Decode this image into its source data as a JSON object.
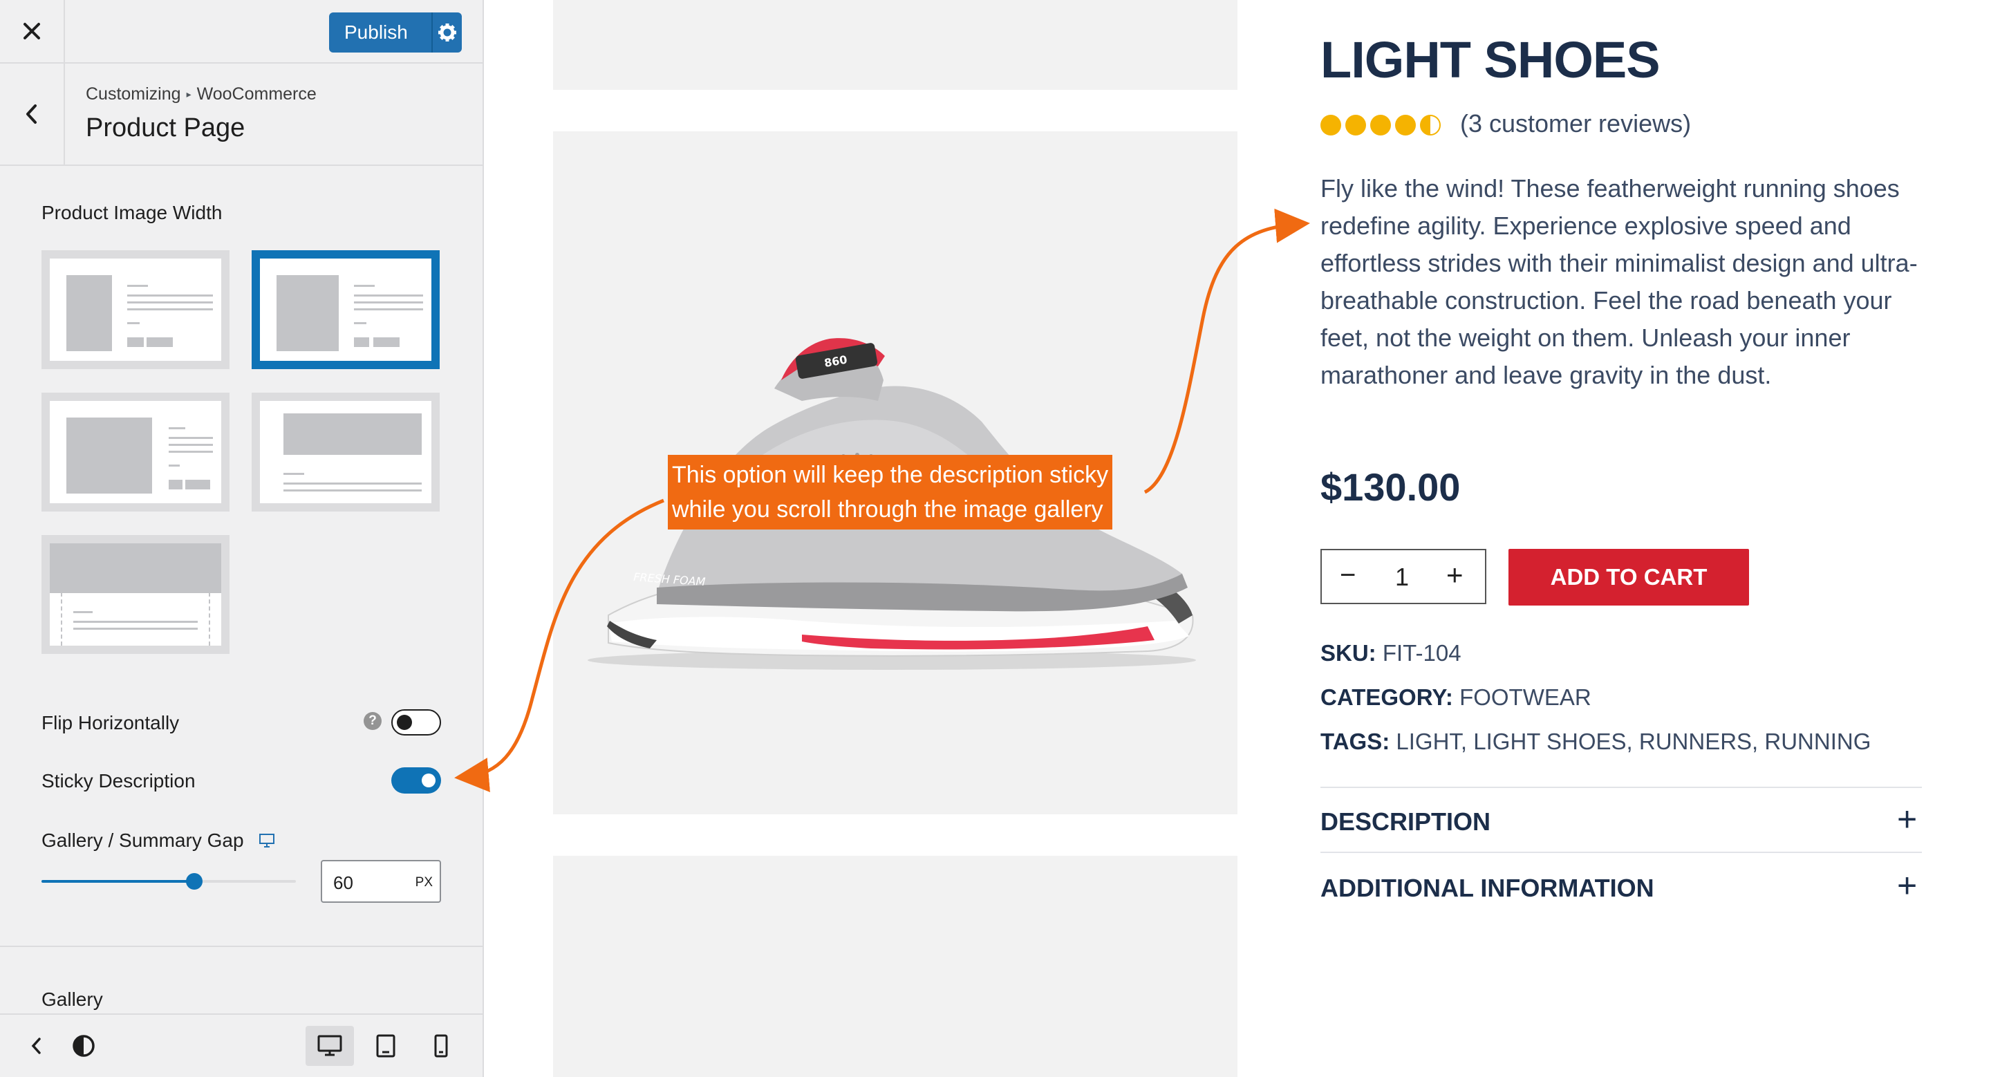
{
  "sidebar": {
    "publish_label": "Publish",
    "breadcrumb": {
      "root": "Customizing",
      "separator": "▸",
      "section": "WooCommerce"
    },
    "panel_title": "Product Page",
    "image_width_label": "Product Image Width",
    "flip_label": "Flip Horizontally",
    "flip_help": "?",
    "flip_enabled": false,
    "sticky_label": "Sticky Description",
    "sticky_enabled": true,
    "gap_label": "Gallery / Summary Gap",
    "gap_value": "60",
    "gap_unit": "PX",
    "gap_fraction": 0.6,
    "gallery_label": "Gallery"
  },
  "callout": {
    "line1": "This option will keep the description sticky",
    "line2": "while you scroll through the image gallery"
  },
  "product": {
    "title": "LIGHT SHOES",
    "rating": 4.5,
    "reviews": "(3 customer reviews)",
    "description": "Fly like the wind! These featherweight running shoes redefine agility. Experience explosive speed and effortless strides with their minimalist design and ultra-breathable construction. Feel the road beneath your feet, not the weight on them. Unleash your inner marathoner and leave gravity in the dust.",
    "price": "$130.00",
    "qty_minus": "−",
    "qty_value": "1",
    "qty_plus": "+",
    "add_to_cart": "ADD TO CART",
    "sku_label": "SKU:",
    "sku_value": "FIT-104",
    "category_label": "CATEGORY:",
    "category_value": "FOOTWEAR",
    "tags_label": "TAGS:",
    "tags_value": "LIGHT, LIGHT SHOES, RUNNERS, RUNNING",
    "accordion": [
      {
        "title": "DESCRIPTION",
        "toggle": "+"
      },
      {
        "title": "ADDITIONAL INFORMATION",
        "toggle": "+"
      }
    ],
    "shoe_tongue_text": "860",
    "shoe_midsole_text": "FRESH FOAM"
  },
  "colors": {
    "accent": "#0f73b6",
    "callout": "#f06a12",
    "cart": "#d4212f",
    "star": "#f5b301",
    "heading": "#1c2e4a"
  }
}
